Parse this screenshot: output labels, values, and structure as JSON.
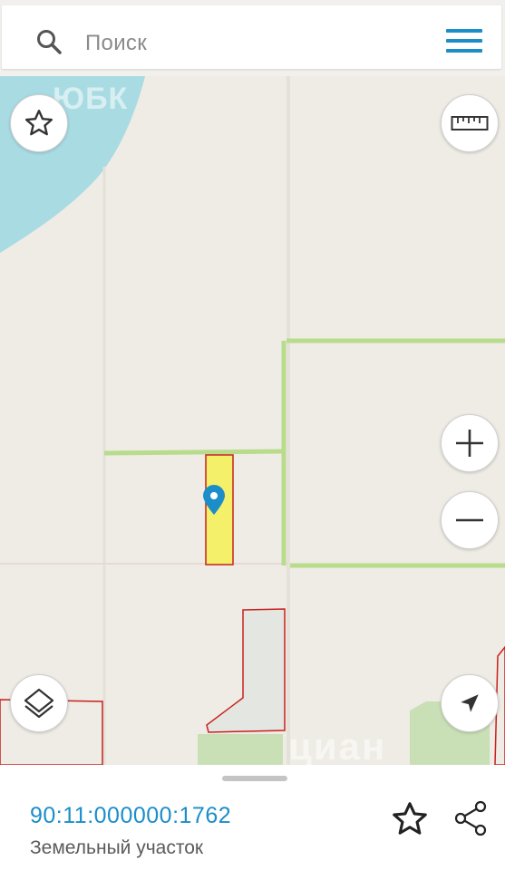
{
  "search": {
    "placeholder": "Поиск",
    "icon": "search-icon",
    "menu_icon": "menu-icon"
  },
  "map": {
    "watermark_top": "ЮБК",
    "watermark_bottom": "циан",
    "colors": {
      "land": "#eeece4",
      "water": "#a9dbe3",
      "field_border": "#b9dc8c",
      "selected_parcel_fill": "#f4f06a",
      "selected_parcel_border": "#c8201e",
      "marker": "#1b8ec9",
      "green_area": "#c9dfb6"
    },
    "controls": {
      "favorite": "star-icon",
      "ruler": "ruler-icon",
      "zoom_in": "plus-icon",
      "zoom_out": "minus-icon",
      "layers": "layers-icon",
      "locate": "navigation-arrow-icon"
    }
  },
  "sheet": {
    "cadastral_number": "90:11:000000:1762",
    "object_type": "Земельный участок",
    "favorite_icon": "star-outline-icon",
    "share_icon": "share-icon"
  }
}
